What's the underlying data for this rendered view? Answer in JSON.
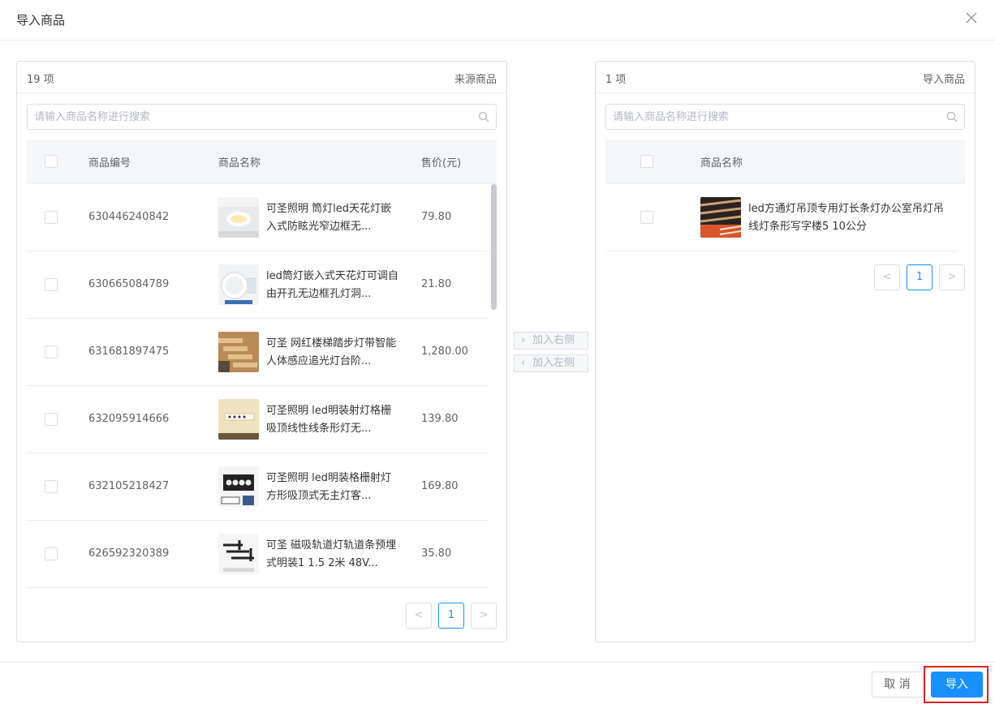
{
  "dialog": {
    "title": "导入商品"
  },
  "left": {
    "count": "19 项",
    "name": "来源商品",
    "search_placeholder": "请输入商品名称进行搜索",
    "columns": {
      "code": "商品编号",
      "name": "商品名称",
      "price": "售价(元)"
    },
    "rows": [
      {
        "code": "630446240842",
        "name": "可圣照明 筒灯led天花灯嵌入式防眩光窄边框无...",
        "price": "79.80"
      },
      {
        "code": "630665084789",
        "name": "led筒灯嵌入式天花灯可调自由开孔无边框孔灯洞...",
        "price": "21.80"
      },
      {
        "code": "631681897475",
        "name": "可圣 网红楼梯踏步灯带智能人体感应追光灯台阶...",
        "price": "1,280.00"
      },
      {
        "code": "632095914666",
        "name": "可圣照明 led明装射灯格栅吸顶线性线条形灯无...",
        "price": "139.80"
      },
      {
        "code": "632105218427",
        "name": "可圣照明 led明装格栅射灯方形吸顶式无主灯客...",
        "price": "169.80"
      },
      {
        "code": "626592320389",
        "name": "可圣 磁吸轨道灯轨道条预埋式明装1 1.5 2米 48V...",
        "price": "35.80"
      }
    ],
    "pager": {
      "prev": "<",
      "page": "1",
      "next": ">"
    }
  },
  "transfer": {
    "to_right": "加入右侧",
    "to_left": "加入左侧"
  },
  "right": {
    "count": "1 项",
    "name": "导入商品",
    "search_placeholder": "请输入商品名称进行搜索",
    "columns": {
      "name": "商品名称"
    },
    "rows": [
      {
        "name": "led方通灯吊顶专用灯长条灯办公室吊灯吊线灯条形写字楼5 10公分"
      }
    ],
    "pager": {
      "prev": "<",
      "page": "1",
      "next": ">"
    }
  },
  "footer": {
    "cancel": "取 消",
    "import": "导入"
  },
  "colors": {
    "primary": "#1890ff",
    "highlight": "#e02020",
    "border": "#dcdfe6"
  },
  "icons": {
    "close": "close-icon",
    "search": "search-icon"
  }
}
